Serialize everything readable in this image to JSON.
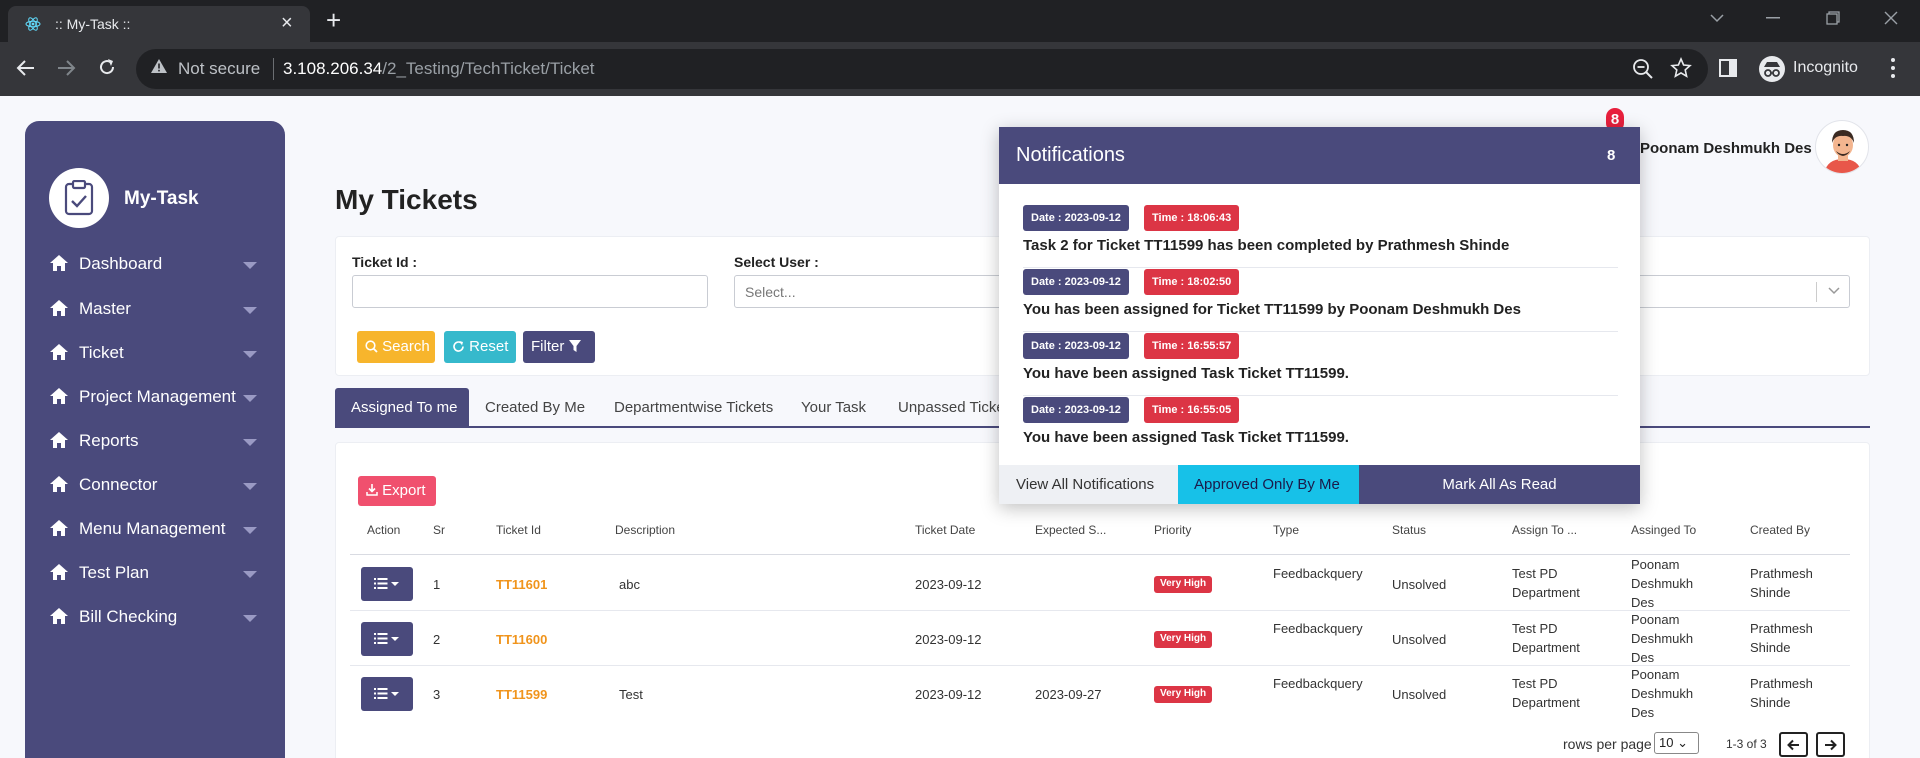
{
  "browser": {
    "tab_title": ":: My-Task ::",
    "not_secure": "Not secure",
    "url_host": "3.108.206.34",
    "url_path": "/2_Testing/TechTicket/Ticket",
    "incognito": "Incognito"
  },
  "sidebar": {
    "brand": "My-Task",
    "items": [
      {
        "label": "Dashboard"
      },
      {
        "label": "Master"
      },
      {
        "label": "Ticket"
      },
      {
        "label": "Project Management"
      },
      {
        "label": "Reports"
      },
      {
        "label": "Connector"
      },
      {
        "label": "Menu Management"
      },
      {
        "label": "Test Plan"
      },
      {
        "label": "Bill Checking"
      }
    ]
  },
  "header": {
    "notification_badge": "8",
    "user_name": "Poonam Deshmukh Des"
  },
  "page": {
    "title": "My Tickets"
  },
  "filters": {
    "ticket_id_label": "Ticket Id :",
    "select_user_label": "Select User :",
    "select_user_placeholder": "Select...",
    "search_label": "Search",
    "reset_label": "Reset",
    "filter_label": "Filter"
  },
  "tabs": [
    {
      "label": "Assigned To me"
    },
    {
      "label": "Created By Me"
    },
    {
      "label": "Departmentwise Tickets"
    },
    {
      "label": "Your Task"
    },
    {
      "label": "Unpassed Ticke"
    }
  ],
  "table": {
    "export_label": "Export",
    "headers": [
      "Action",
      "Sr",
      "Ticket Id",
      "Description",
      "Ticket Date",
      "Expected S...",
      "Priority",
      "Type",
      "Status",
      "Assign To ...",
      "Assinged To",
      "Created By"
    ],
    "rows": [
      {
        "sr": "1",
        "ticket_id": "TT11601",
        "description": "abc",
        "ticket_date": "2023-09-12",
        "expected": "",
        "priority": "Very High",
        "type": "Feedbackquery",
        "status": "Unsolved",
        "assign_to_dept": "Test PD Department",
        "assigned_to": "Poonam Deshmukh Des",
        "created_by": "Prathmesh Shinde"
      },
      {
        "sr": "2",
        "ticket_id": "TT11600",
        "description": "",
        "ticket_date": "2023-09-12",
        "expected": "",
        "priority": "Very High",
        "type": "Feedbackquery",
        "status": "Unsolved",
        "assign_to_dept": "Test PD Department",
        "assigned_to": "Poonam Deshmukh Des",
        "created_by": "Prathmesh Shinde"
      },
      {
        "sr": "3",
        "ticket_id": "TT11599",
        "description": "Test",
        "ticket_date": "2023-09-12",
        "expected": "2023-09-27",
        "priority": "Very High",
        "type": "Feedbackquery",
        "status": "Unsolved",
        "assign_to_dept": "Test PD Department",
        "assigned_to": "Poonam Deshmukh Des",
        "created_by": "Prathmesh Shinde"
      }
    ]
  },
  "pagination": {
    "rows_per_page_label": "rows per page",
    "rows_per_page_value": "10",
    "range": "1-3 of 3"
  },
  "notifications": {
    "title": "Notifications",
    "count": "8",
    "items": [
      {
        "date": "Date : 2023-09-12",
        "time": "Time : 18:06:43",
        "message": "Task 2 for Ticket TT11599 has been completed by Prathmesh Shinde"
      },
      {
        "date": "Date : 2023-09-12",
        "time": "Time : 18:02:50",
        "message": "You has been assigned for Ticket TT11599 by Poonam Deshmukh Des"
      },
      {
        "date": "Date : 2023-09-12",
        "time": "Time : 16:55:57",
        "message": "You have been assigned Task Ticket TT11599."
      },
      {
        "date": "Date : 2023-09-12",
        "time": "Time : 16:55:05",
        "message": "You have been assigned Task Ticket TT11599."
      }
    ],
    "view_all": "View All Notifications",
    "approved_only": "Approved Only By Me",
    "mark_all_read": "Mark All As Read"
  },
  "colors": {
    "primary": "#4a4a7c",
    "danger": "#dc3545",
    "warning": "#f7b52c",
    "info": "#36b9cc",
    "accent_orange": "#f0941c",
    "cyan": "#17c1e8"
  },
  "icons": [
    "react-favicon-icon",
    "home-icon",
    "clipboard-check-icon",
    "search-icon",
    "refresh-icon",
    "filter-icon",
    "download-icon",
    "list-icon",
    "caret-down-icon",
    "arrow-left-icon",
    "arrow-right-icon",
    "incognito-icon",
    "zoom-icon",
    "star-icon",
    "side-panel-icon",
    "menu-dots-icon"
  ]
}
